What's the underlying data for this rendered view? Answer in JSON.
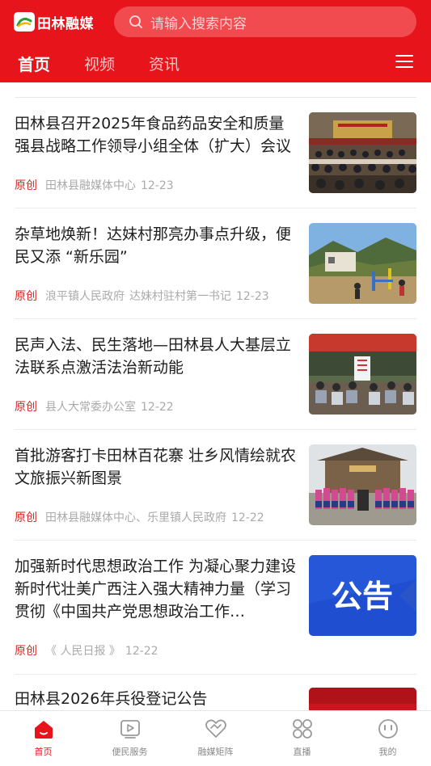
{
  "header": {
    "logo_text": "田林融媒",
    "search_placeholder": "请输入搜索内容",
    "tabs": [
      "首页",
      "视频",
      "资讯"
    ],
    "brand_color": "#e8141b"
  },
  "articles": [
    {
      "title": "田林县召开2025年食品药品安全和质量强县战略工作领导小组全体（扩大）会议",
      "tag": "原创",
      "source": "田林县融媒体中心",
      "source2": "",
      "date": "12-23",
      "thumb": "meeting-hall-photo"
    },
    {
      "title": "杂草地焕新！达妹村那亮办事点升级，便民又添 “新乐园”",
      "tag": "原创",
      "source": "浪平镇人民政府",
      "source2": "达妹村驻村第一书记",
      "date": "12-23",
      "thumb": "village-playground-photo"
    },
    {
      "title": "民声入法、民生落地—田林县人大基层立法联系点激活法治新动能",
      "tag": "原创",
      "source": "县人大常委办公室",
      "source2": "",
      "date": "12-22",
      "thumb": "community-meeting-photo"
    },
    {
      "title": "首批游客打卡田林百花寨 壮乡风情绘就农文旅振兴新图景",
      "tag": "原创",
      "source": "田林县融媒体中心、乐里镇人民政府",
      "source2": "",
      "date": "12-22",
      "thumb": "ethnic-costume-group-photo"
    },
    {
      "title": "加强新时代思想政治工作 为凝心聚力建设新时代壮美广西注入强大精神力量（学习贯彻《中国共产党思想政治工作…",
      "tag": "原创",
      "source": "《 人民日报 》",
      "source2": "",
      "date": "12-22",
      "thumb": "announcement-banner",
      "thumb_text": "公告"
    },
    {
      "title": "田林县2026年兵役登记公告",
      "tag": "",
      "source": "",
      "source2": "",
      "date": "",
      "thumb": "red-banner"
    }
  ],
  "bottom_nav": [
    {
      "label": "首页",
      "icon": "home-icon",
      "active": true
    },
    {
      "label": "便民服务",
      "icon": "play-square-icon",
      "active": false
    },
    {
      "label": "融媒矩阵",
      "icon": "heart-link-icon",
      "active": false
    },
    {
      "label": "直播",
      "icon": "grid-icon",
      "active": false
    },
    {
      "label": "我的",
      "icon": "smile-face-icon",
      "active": false
    }
  ]
}
